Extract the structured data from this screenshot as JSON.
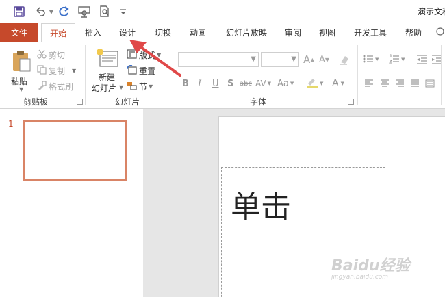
{
  "window": {
    "doc_title": "演示文稿"
  },
  "qat": {
    "icons": [
      "save-icon",
      "undo-icon",
      "redo-icon",
      "present-from-start-icon",
      "print-preview-icon",
      "customize-qat-icon"
    ]
  },
  "tabs": [
    "文件",
    "开始",
    "插入",
    "设计",
    "切换",
    "动画",
    "幻灯片放映",
    "审阅",
    "视图",
    "开发工具",
    "帮助"
  ],
  "ribbon": {
    "clipboard": {
      "paste": "粘贴",
      "cut": "剪切",
      "copy": "复制",
      "format_painter": "格式刷",
      "label": "剪贴板"
    },
    "slides": {
      "new_slide_line1": "新建",
      "new_slide_line2": "幻灯片",
      "layout": "版式",
      "reset": "重置",
      "section": "节",
      "label": "幻灯片"
    },
    "font": {
      "label": "字体",
      "font_name_value": "",
      "font_size_value": "",
      "increase_size": "A",
      "decrease_size": "A",
      "bold": "B",
      "italic": "I",
      "underline": "U",
      "shadow": "S",
      "strikethrough": "abc",
      "char_spacing": "AV",
      "change_case": "Aa",
      "font_color": "A"
    }
  },
  "slides_pane": {
    "slide_number": "1"
  },
  "editor": {
    "title_hint": "单击"
  },
  "watermark": {
    "line1": "Baidu经验",
    "line2": "jingyan.baidu.com"
  },
  "colors": {
    "accent": "#c6492b",
    "thumb_border": "#d98466",
    "arrow": "#e04848"
  }
}
